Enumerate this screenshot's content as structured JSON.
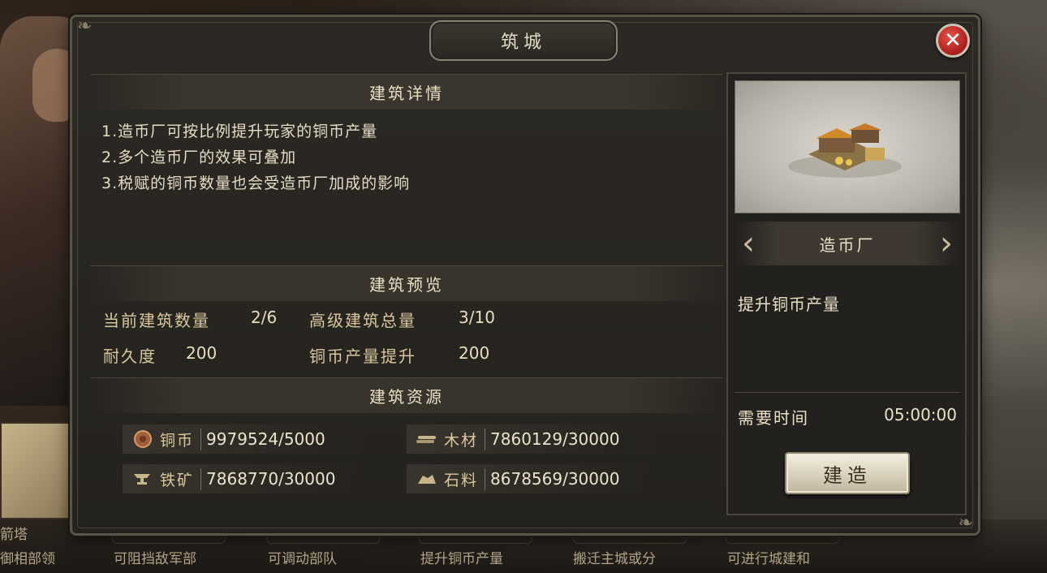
{
  "dialog": {
    "title": "筑城",
    "close_label": "✕"
  },
  "details": {
    "header": "建筑详情",
    "lines": [
      "1.造币厂可按比例提升玩家的铜币产量",
      "2.多个造币厂的效果可叠加",
      "3.税赋的铜币数量也会受造币厂加成的影响"
    ]
  },
  "preview_section": {
    "header": "建筑预览",
    "stats": [
      {
        "label": "当前建筑数量",
        "value": "2/6"
      },
      {
        "label": "高级建筑总量",
        "value": "3/10"
      },
      {
        "label": "耐久度",
        "value": "200"
      },
      {
        "label": "铜币产量提升",
        "value": "200"
      }
    ]
  },
  "resources": {
    "header": "建筑资源",
    "items": [
      {
        "name": "铜币",
        "value": "9979524/5000",
        "icon": "copper-coin-icon"
      },
      {
        "name": "木材",
        "value": "7860129/30000",
        "icon": "wood-icon"
      },
      {
        "name": "铁矿",
        "value": "7868770/30000",
        "icon": "iron-anvil-icon"
      },
      {
        "name": "石料",
        "value": "8678569/30000",
        "icon": "stone-icon"
      }
    ]
  },
  "building": {
    "name": "造币厂",
    "description": "提升铜币产量",
    "time_label": "需要时间",
    "time_value": "05:00:00",
    "build_label": "建造"
  },
  "background": {
    "left_tab_label": "箭塔",
    "bottom_texts": [
      "御相部领",
      "可阻挡敌军部",
      "可调动部队",
      "提升铜币产量",
      "搬迁主城或分",
      "可进行城建和"
    ]
  },
  "colors": {
    "close_red": "#c62a24",
    "panel_bg": "#24221e",
    "text_gold": "#d9c79e"
  }
}
